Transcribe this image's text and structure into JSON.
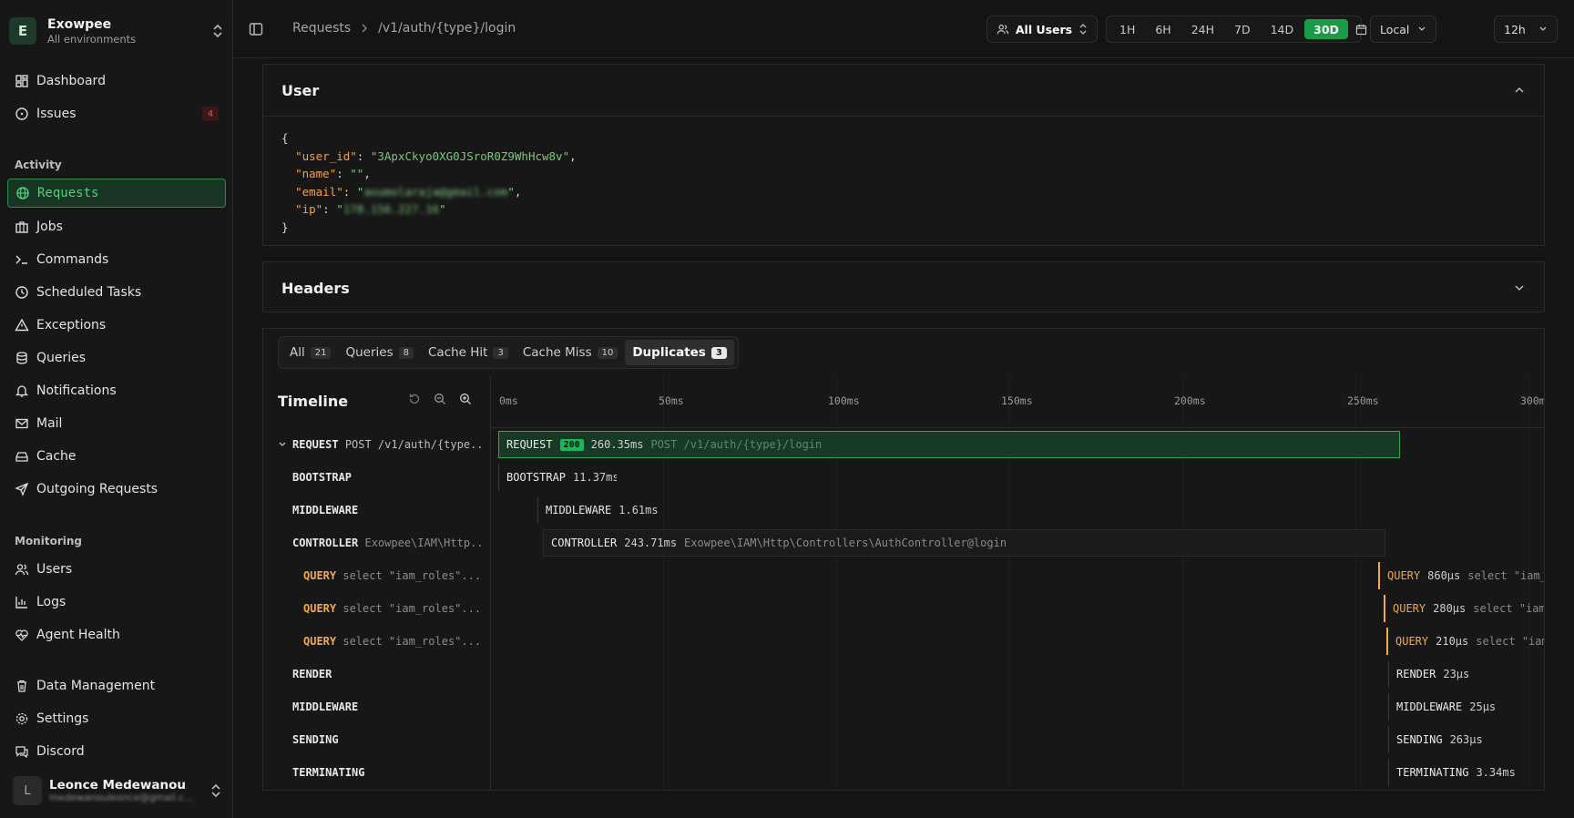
{
  "team": {
    "initial": "E",
    "name": "Exowpee",
    "subtitle": "All environments"
  },
  "nav_top": [
    {
      "label": "Dashboard",
      "icon": "dashboard-icon"
    },
    {
      "label": "Issues",
      "icon": "issues-icon",
      "badge": "4"
    }
  ],
  "sections": {
    "activity": "Activity",
    "monitoring": "Monitoring"
  },
  "nav_activity": [
    {
      "label": "Requests",
      "icon": "globe-icon",
      "active": true
    },
    {
      "label": "Jobs",
      "icon": "briefcase-icon"
    },
    {
      "label": "Commands",
      "icon": "terminal-icon"
    },
    {
      "label": "Scheduled Tasks",
      "icon": "clock-icon"
    },
    {
      "label": "Exceptions",
      "icon": "warning-icon"
    },
    {
      "label": "Queries",
      "icon": "database-icon"
    },
    {
      "label": "Notifications",
      "icon": "bell-icon"
    },
    {
      "label": "Mail",
      "icon": "mail-icon"
    },
    {
      "label": "Cache",
      "icon": "cache-icon"
    },
    {
      "label": "Outgoing Requests",
      "icon": "send-icon"
    }
  ],
  "nav_monitoring": [
    {
      "label": "Users",
      "icon": "users-icon"
    },
    {
      "label": "Logs",
      "icon": "chart-icon"
    },
    {
      "label": "Agent Health",
      "icon": "heart-pulse-icon"
    }
  ],
  "nav_bottom": [
    {
      "label": "Data Management",
      "icon": "trash-icon"
    },
    {
      "label": "Settings",
      "icon": "gear-icon"
    },
    {
      "label": "Discord",
      "icon": "discord-icon"
    }
  ],
  "account": {
    "initial": "L",
    "name": "Leonce Medewanou",
    "email": "medewanouleonce@gmail.c..."
  },
  "breadcrumb": {
    "root": "Requests",
    "current": "/v1/auth/{type}/login"
  },
  "filters": {
    "users": "All Users",
    "ranges": [
      "1H",
      "6H",
      "24H",
      "7D",
      "14D",
      "30D"
    ],
    "selected_range": "30D",
    "timezone": "Local",
    "clock": "12h"
  },
  "user_panel": {
    "title": "User",
    "json": {
      "user_id_key": "\"user_id\"",
      "user_id": "\"3ApxCkyo0XG0JSroR0Z9WhHcw8v\"",
      "name_key": "\"name\"",
      "name": "\"\"",
      "email_key": "\"email\"",
      "email": "aoumolaraja@gmail.com",
      "ip_key": "\"ip\"",
      "ip": "178.156.227.16"
    }
  },
  "headers_panel": {
    "title": "Headers"
  },
  "tabs": [
    {
      "label": "All",
      "count": "21"
    },
    {
      "label": "Queries",
      "count": "8"
    },
    {
      "label": "Cache Hit",
      "count": "3"
    },
    {
      "label": "Cache Miss",
      "count": "10"
    },
    {
      "label": "Duplicates",
      "count": "3",
      "selected": true
    }
  ],
  "timeline": {
    "title": "Timeline",
    "ticks": [
      "0ms",
      "50ms",
      "100ms",
      "150ms",
      "200ms",
      "250ms",
      "300m"
    ],
    "rows": [
      {
        "name": "REQUEST",
        "detail": "POST /v1/auth/{type...",
        "bar_name": "REQUEST",
        "status": "200",
        "duration": "260.35ms",
        "bar_detail": "POST /v1/auth/{type}/login"
      },
      {
        "name": "BOOTSTRAP",
        "bar_name": "BOOTSTRAP",
        "duration": "11.37ms"
      },
      {
        "name": "MIDDLEWARE",
        "bar_name": "MIDDLEWARE",
        "duration": "1.61ms"
      },
      {
        "name": "CONTROLLER",
        "detail": "Exowpee\\IAM\\Http...",
        "bar_name": "CONTROLLER",
        "duration": "243.71ms",
        "bar_detail": "Exowpee\\IAM\\Http\\Controllers\\AuthController@login"
      },
      {
        "name": "QUERY",
        "detail": "select \"iam_roles\"....",
        "bar_name": "QUERY",
        "duration": "860µs",
        "bar_detail": "select \"iam_"
      },
      {
        "name": "QUERY",
        "detail": "select \"iam_roles\"....",
        "bar_name": "QUERY",
        "duration": "280µs",
        "bar_detail": "select \"iam_"
      },
      {
        "name": "QUERY",
        "detail": "select \"iam_roles\"....",
        "bar_name": "QUERY",
        "duration": "210µs",
        "bar_detail": "select \"iam_"
      },
      {
        "name": "RENDER",
        "bar_name": "RENDER",
        "duration": "23µs"
      },
      {
        "name": "MIDDLEWARE",
        "bar_name": "MIDDLEWARE",
        "duration": "25µs"
      },
      {
        "name": "SENDING",
        "bar_name": "SENDING",
        "duration": "263µs"
      },
      {
        "name": "TERMINATING",
        "bar_name": "TERMINATING",
        "duration": "3.34ms"
      }
    ]
  }
}
